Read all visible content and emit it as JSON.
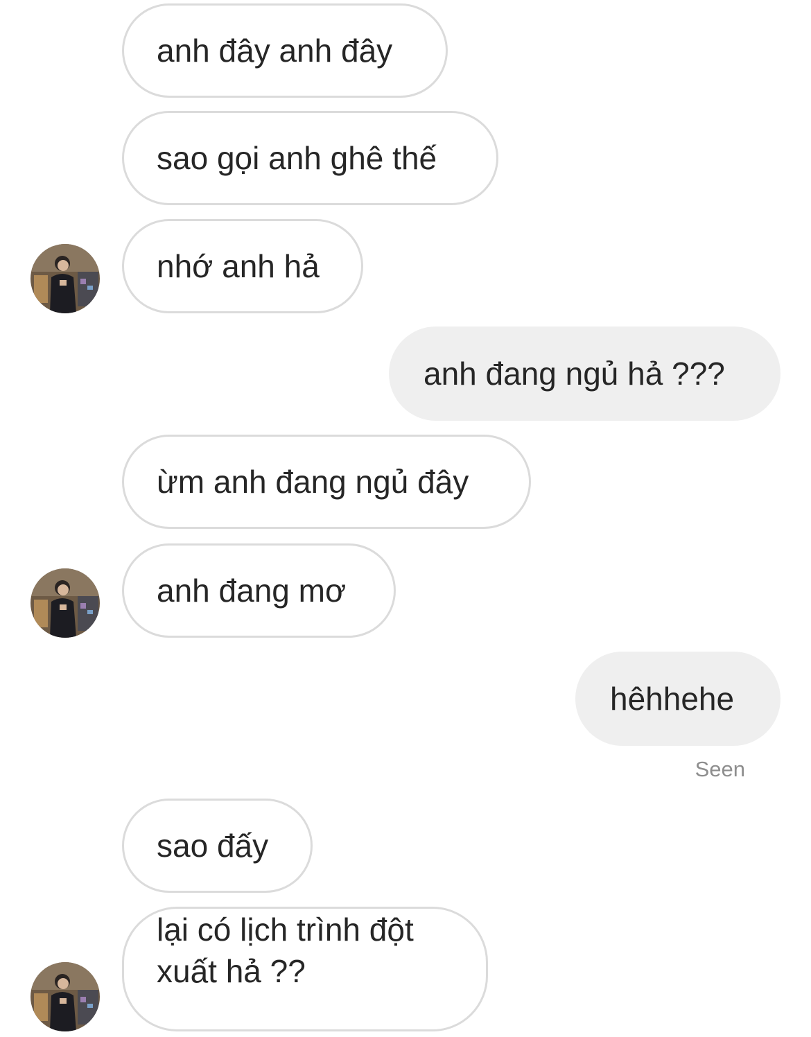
{
  "messages": [
    {
      "sender": "them",
      "text": "anh đây anh đây"
    },
    {
      "sender": "them",
      "text": "sao gọi anh ghê thế"
    },
    {
      "sender": "them",
      "text": "nhớ anh hả"
    },
    {
      "sender": "me",
      "text": "anh đang ngủ hả ???"
    },
    {
      "sender": "them",
      "text": "ừm anh đang ngủ đây"
    },
    {
      "sender": "them",
      "text": "anh đang mơ"
    },
    {
      "sender": "me",
      "text": "hêhhehe"
    },
    {
      "sender": "them",
      "text": "sao đấy"
    },
    {
      "sender": "them",
      "lines": [
        "lại có lịch trình đột",
        "xuất hả ??"
      ]
    }
  ],
  "status": {
    "seen_label": "Seen"
  },
  "colors": {
    "incoming_bubble_border": "#dbdbdb",
    "outgoing_bubble_bg": "#efefef",
    "text": "#262626",
    "seen_text": "#8e8e8e"
  },
  "icons": {
    "avatar": "contact-avatar-photo"
  }
}
